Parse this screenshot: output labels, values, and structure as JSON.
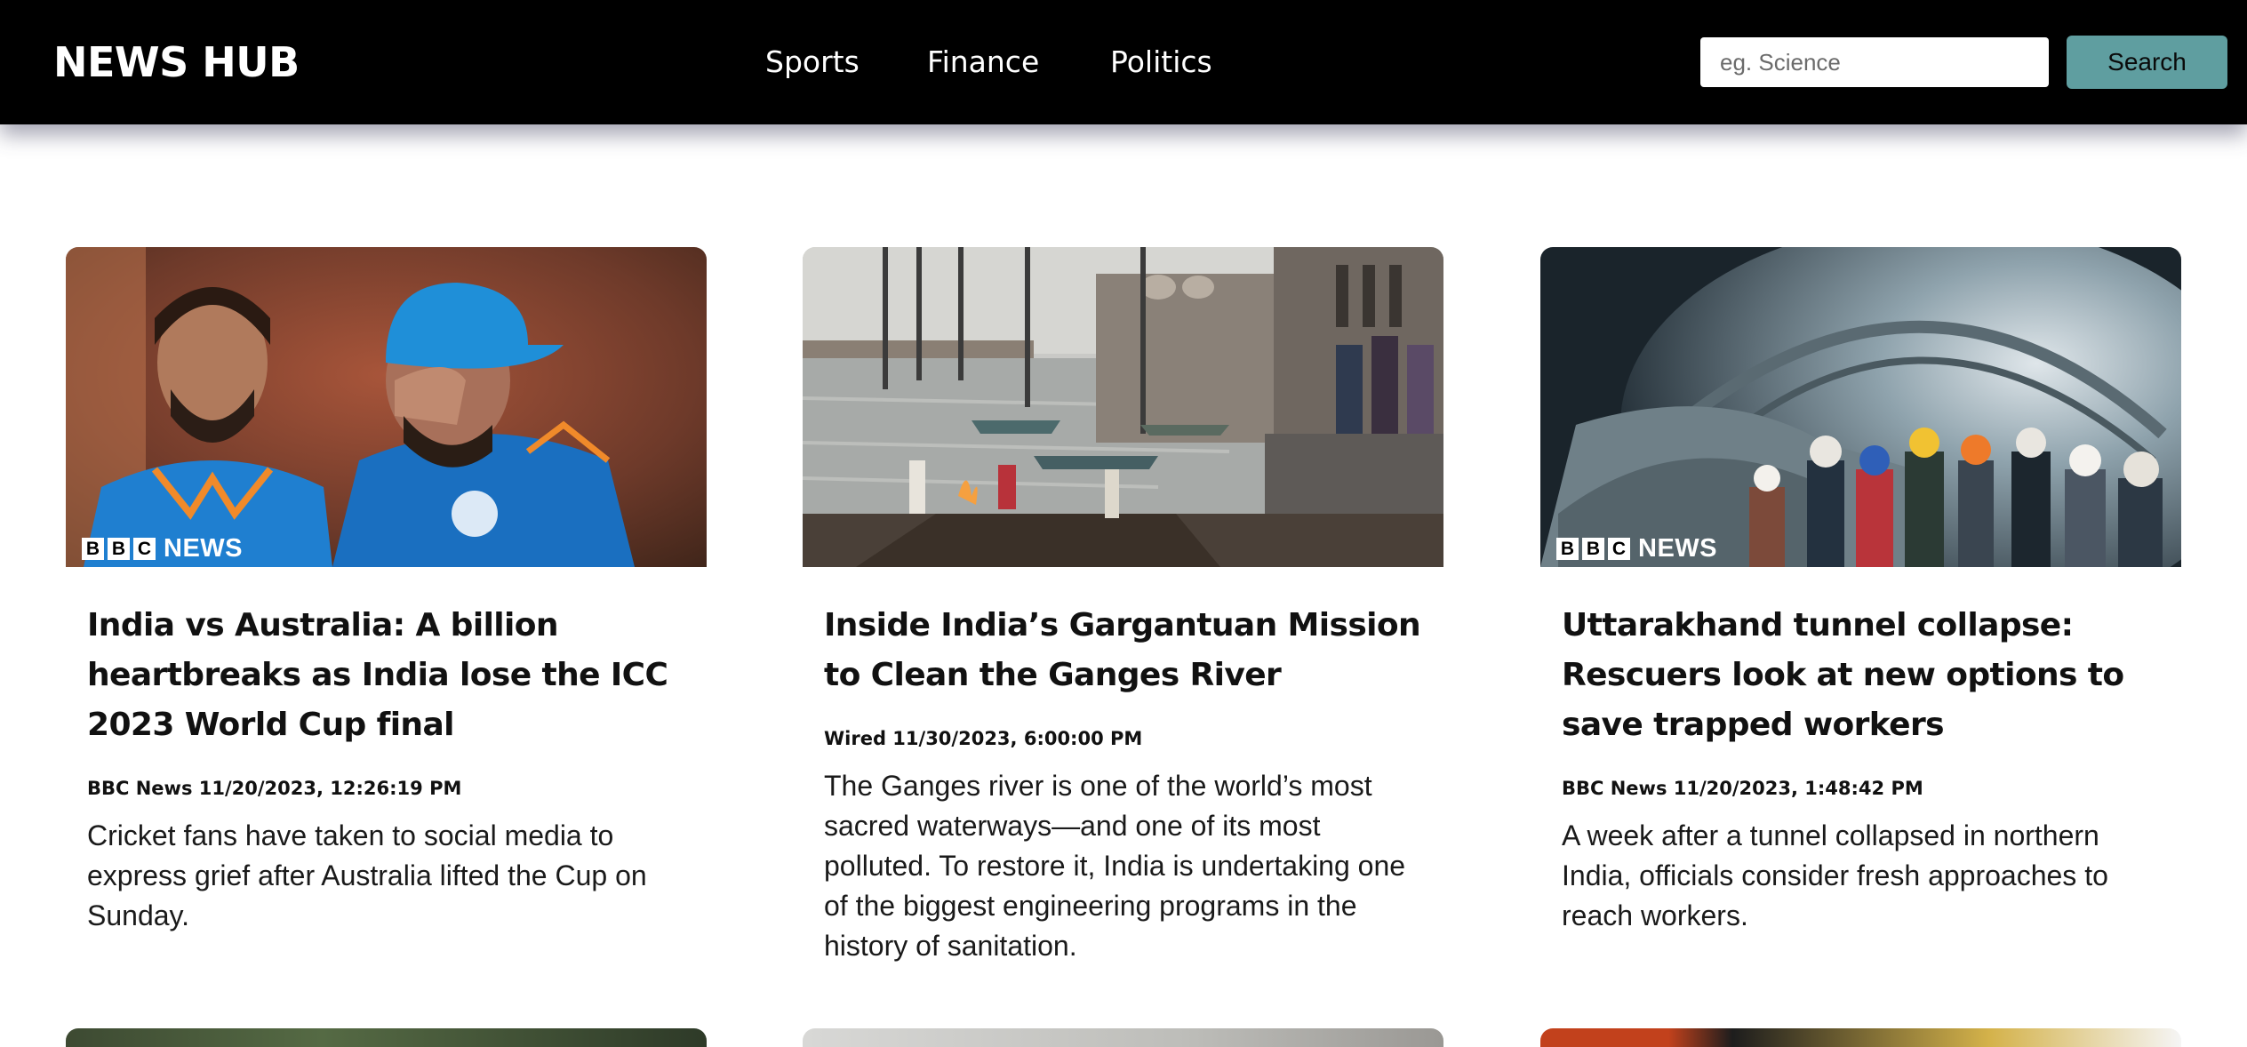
{
  "header": {
    "brand": "NEWS HUB",
    "nav": [
      "Sports",
      "Finance",
      "Politics"
    ],
    "search": {
      "placeholder": "eg. Science",
      "value": "",
      "button_label": "Search"
    }
  },
  "colors": {
    "header_bg": "#000000",
    "search_button": "#5f9ea0",
    "page_bg": "#ffffff"
  },
  "badge": {
    "letters": [
      "B",
      "B",
      "C"
    ],
    "word": "NEWS"
  },
  "articles": [
    {
      "title": "India vs Australia: A billion heartbreaks as India lose the ICC 2023 World Cup final",
      "meta": "BBC News 11/20/2023, 12:26:19 PM",
      "description": "Cricket fans have taken to social media to express grief after Australia lifted the Cup on Sunday."
    },
    {
      "title": "Inside India’s Gargantuan Mission to Clean the Ganges River",
      "meta": "Wired 11/30/2023, 6:00:00 PM",
      "description": "The Ganges river is one of the world’s most sacred waterways—and one of its most polluted. To restore it, India is undertaking one of the biggest engineering programs in the history of sanitation."
    },
    {
      "title": "Uttarakhand tunnel collapse: Rescuers look at new options to save trapped workers",
      "meta": "BBC News 11/20/2023, 1:48:42 PM",
      "description": "A week after a tunnel collapsed in northern India, officials consider fresh approaches to reach workers."
    }
  ]
}
